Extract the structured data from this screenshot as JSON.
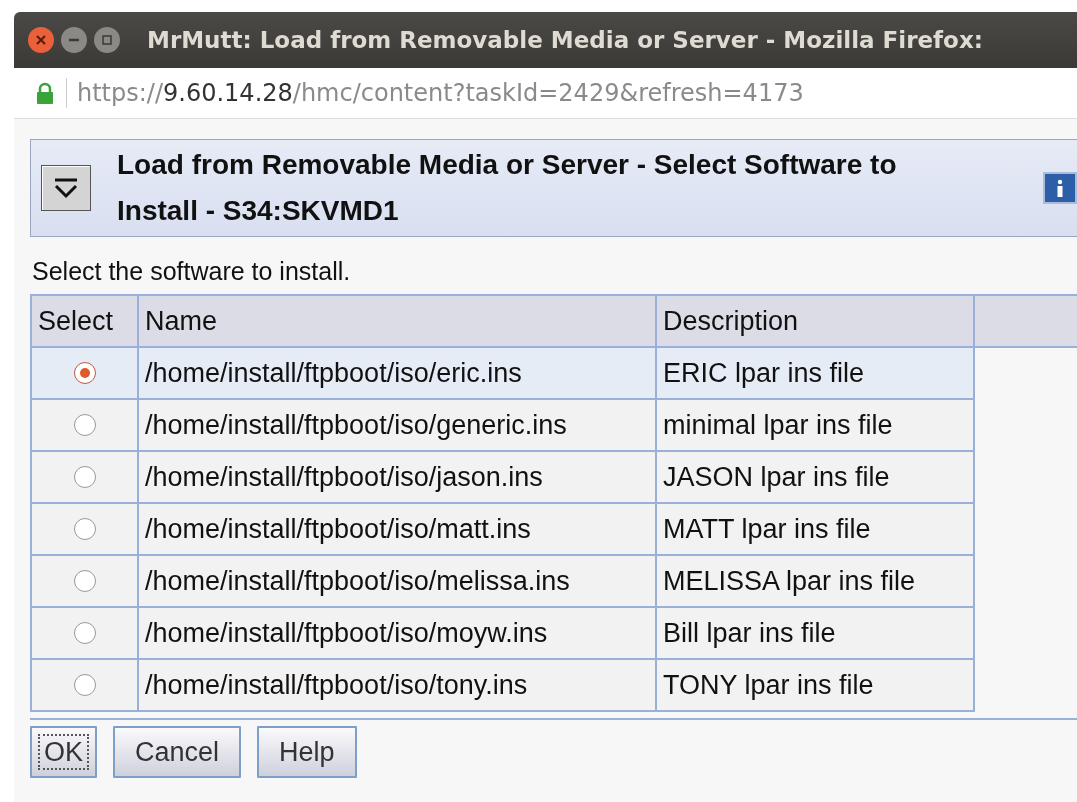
{
  "window": {
    "title": "MrMutt: Load from Removable Media or Server - Mozilla Firefox:"
  },
  "address_bar": {
    "secure": true,
    "scheme": "https://",
    "host": "9.60.14.28",
    "path": "/hmc/content?taskId=2429&refresh=4173"
  },
  "panel": {
    "title": "Load from Removable Media or Server - Select Software to Install - S34:SKVMD1",
    "expanded": true
  },
  "instruction": "Select the software to install.",
  "table": {
    "columns": [
      "Select",
      "Name",
      "Description"
    ],
    "rows": [
      {
        "selected": true,
        "name": "/home/install/ftpboot/iso/eric.ins",
        "description": "ERIC lpar ins file"
      },
      {
        "selected": false,
        "name": "/home/install/ftpboot/iso/generic.ins",
        "description": "minimal lpar ins file"
      },
      {
        "selected": false,
        "name": "/home/install/ftpboot/iso/jason.ins",
        "description": "JASON lpar ins file"
      },
      {
        "selected": false,
        "name": "/home/install/ftpboot/iso/matt.ins",
        "description": "MATT lpar ins file"
      },
      {
        "selected": false,
        "name": "/home/install/ftpboot/iso/melissa.ins",
        "description": "MELISSA lpar ins file"
      },
      {
        "selected": false,
        "name": "/home/install/ftpboot/iso/moyw.ins",
        "description": "Bill lpar ins file"
      },
      {
        "selected": false,
        "name": "/home/install/ftpboot/iso/tony.ins",
        "description": "TONY lpar ins file"
      }
    ]
  },
  "buttons": [
    {
      "label": "OK",
      "focused": true
    },
    {
      "label": "Cancel",
      "focused": false
    },
    {
      "label": "Help",
      "focused": false
    }
  ]
}
